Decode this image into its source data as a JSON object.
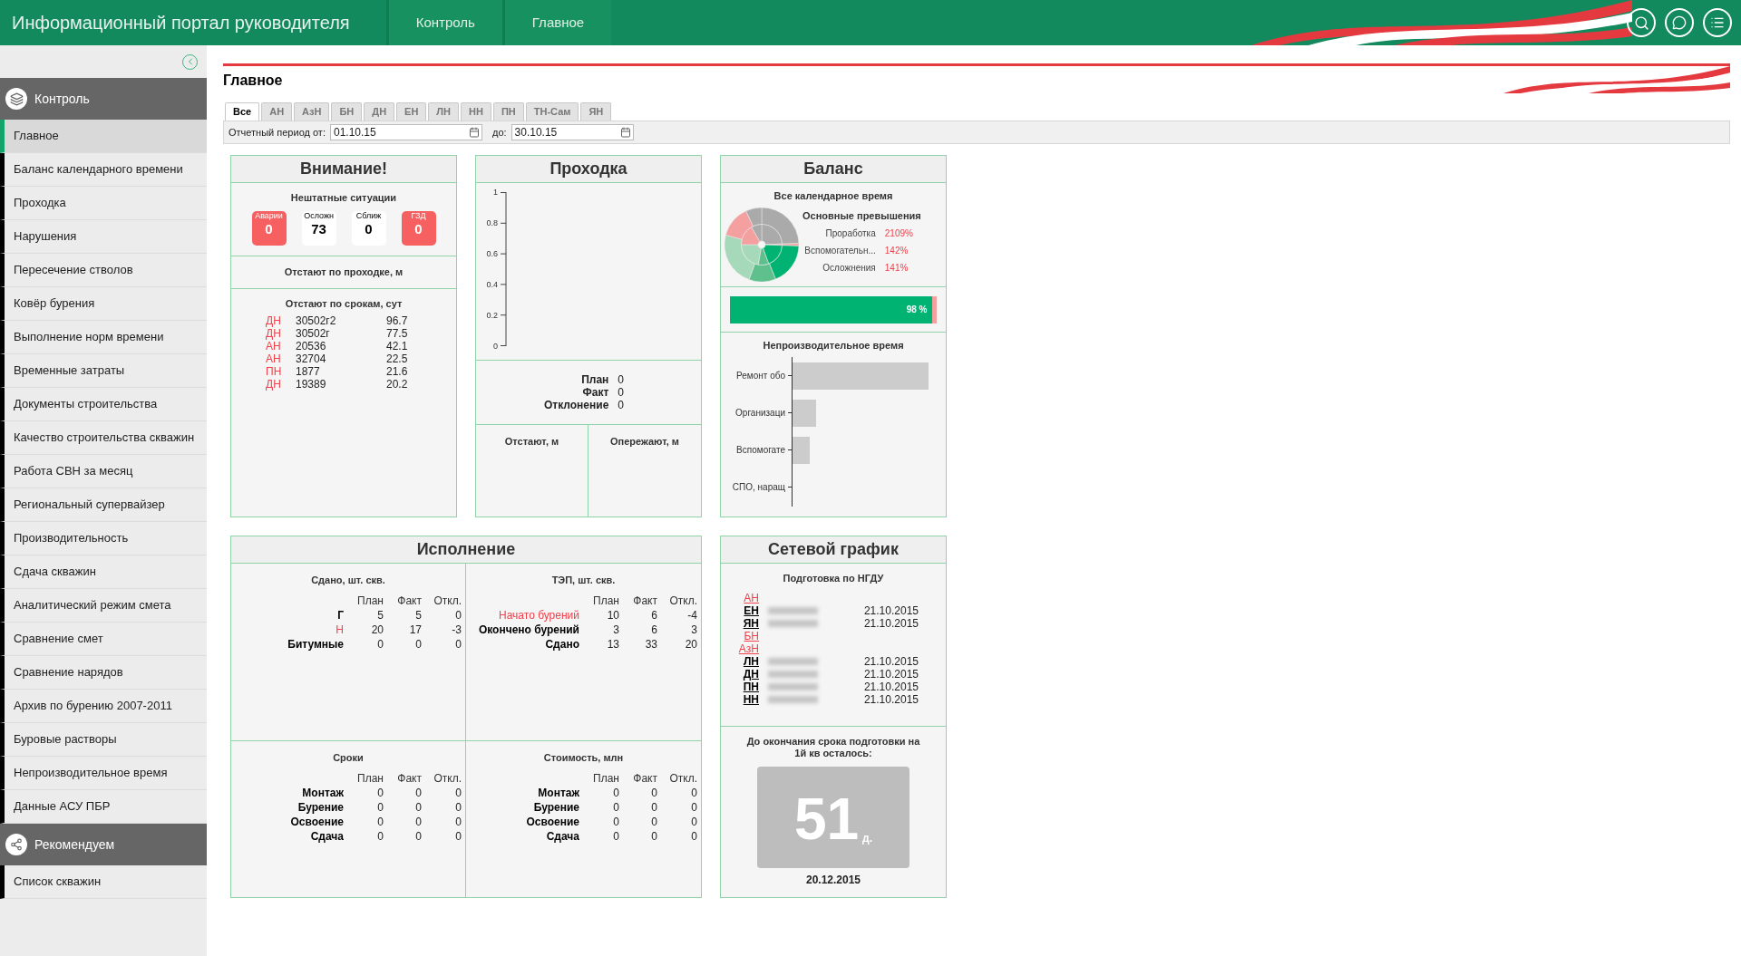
{
  "header": {
    "title": "Информационный портал руководителя",
    "breadcrumbs": [
      "Контроль",
      "Главное"
    ]
  },
  "sidebar": {
    "sections": [
      {
        "title": "Контроль",
        "items": [
          {
            "label": "Главное",
            "selected": true
          },
          {
            "label": "Баланс календарного времени",
            "selected": false
          },
          {
            "label": "Проходка",
            "selected": false
          },
          {
            "label": "Нарушения",
            "selected": false
          },
          {
            "label": "Пересечение стволов",
            "selected": false
          },
          {
            "label": "Ковёр бурения",
            "selected": false
          },
          {
            "label": "Выполнение норм времени",
            "selected": false
          },
          {
            "label": "Временные затраты",
            "selected": false
          },
          {
            "label": "Документы строительства",
            "selected": false
          },
          {
            "label": "Качество строительства скважин",
            "selected": false
          },
          {
            "label": "Работа СВН за месяц",
            "selected": false
          },
          {
            "label": "Региональный супервайзер",
            "selected": false
          },
          {
            "label": "Производительность",
            "selected": false
          },
          {
            "label": "Сдача скважин",
            "selected": false
          },
          {
            "label": "Аналитический режим смета",
            "selected": false
          },
          {
            "label": "Сравнение смет",
            "selected": false
          },
          {
            "label": "Сравнение нарядов",
            "selected": false
          },
          {
            "label": "Архив по бурению 2007-2011",
            "selected": false
          },
          {
            "label": "Буровые растворы",
            "selected": false
          },
          {
            "label": "Непроизводительное время",
            "selected": false
          },
          {
            "label": "Данные АСУ ПБР",
            "selected": false
          }
        ]
      },
      {
        "title": "Рекомендуем",
        "items": [
          {
            "label": "Список скважин",
            "selected": false
          }
        ]
      }
    ]
  },
  "page": {
    "title": "Главное"
  },
  "tabs": [
    {
      "label": "Все",
      "selected": true
    },
    {
      "label": "АН",
      "selected": false
    },
    {
      "label": "АзН",
      "selected": false
    },
    {
      "label": "БН",
      "selected": false
    },
    {
      "label": "ДН",
      "selected": false
    },
    {
      "label": "ЕН",
      "selected": false
    },
    {
      "label": "ЛН",
      "selected": false
    },
    {
      "label": "НН",
      "selected": false
    },
    {
      "label": "ПН",
      "selected": false
    },
    {
      "label": "ТН-Сам",
      "selected": false
    },
    {
      "label": "ЯН",
      "selected": false
    }
  ],
  "period": {
    "from_label": "Отчетный период от:",
    "from": "01.10.15",
    "to_label": "до:",
    "to": "30.10.15"
  },
  "attention": {
    "title": "Внимание!",
    "incidents_title": "Нештатные ситуации",
    "counters": [
      {
        "label": "Аварии",
        "value": "0",
        "alert": true
      },
      {
        "label": "Осложн",
        "value": "73",
        "alert": false
      },
      {
        "label": "Сближ",
        "value": "0",
        "alert": false
      },
      {
        "label": "ГЗД",
        "value": "0",
        "alert": true
      }
    ],
    "drilling_lag_title": "Отстают по проходке, м",
    "deadline_title": "Отстают по срокам, сут",
    "deadline_rows": [
      {
        "unit": "ДН",
        "well": "30502г2",
        "days": "96.7"
      },
      {
        "unit": "ДН",
        "well": "30502г",
        "days": "77.5"
      },
      {
        "unit": "АН",
        "well": "20536",
        "days": "42.1"
      },
      {
        "unit": "АН",
        "well": "32704",
        "days": "22.5"
      },
      {
        "unit": "ПН",
        "well": "1877",
        "days": "21.6"
      },
      {
        "unit": "ДН",
        "well": "19389",
        "days": "20.2"
      }
    ]
  },
  "drilling": {
    "title": "Проходка",
    "axis_labels": [
      "1",
      "0.8",
      "0.6",
      "0.4",
      "0.2",
      "0"
    ],
    "stats": [
      {
        "label": "План",
        "value": "0"
      },
      {
        "label": "Факт",
        "value": "0"
      },
      {
        "label": "Отклонение",
        "value": "0"
      }
    ],
    "behind_title": "Отстают, м",
    "ahead_title": "Опережают, м"
  },
  "balance": {
    "title": "Баланс",
    "calendar_title": "Все календарное время",
    "excess_title": "Основные превышения",
    "excesses": [
      {
        "label": "Проработка",
        "value": "2109%"
      },
      {
        "label": "Вспомогательн...",
        "value": "142%"
      },
      {
        "label": "Осложнения",
        "value": "141%"
      }
    ],
    "progress": {
      "level": 0.98,
      "reading": "98 %"
    },
    "unproductive_title": "Непроизводительное время",
    "unproductive_categories": [
      "Ремонт обо",
      "Организаци",
      "Вспомогате",
      "СПО, наращ"
    ]
  },
  "execution": {
    "title": "Исполнение",
    "tables": [
      {
        "title": "Сдано, шт. скв.",
        "columns": [
          "План",
          "Факт",
          "Откл."
        ],
        "rows": [
          {
            "label": "Г",
            "alert": false,
            "cells": [
              "5",
              "5",
              "0"
            ]
          },
          {
            "label": "Н",
            "alert": true,
            "cells": [
              "20",
              "17",
              "-3"
            ]
          },
          {
            "label": "Битумные",
            "alert": false,
            "cells": [
              "0",
              "0",
              "0"
            ]
          }
        ]
      },
      {
        "title": "ТЭП, шт. скв.",
        "columns": [
          "План",
          "Факт",
          "Откл."
        ],
        "rows": [
          {
            "label": "Начато бурений",
            "alert": true,
            "cells": [
              "10",
              "6",
              "-4"
            ]
          },
          {
            "label": "Окончено бурений",
            "alert": false,
            "cells": [
              "3",
              "6",
              "3"
            ]
          },
          {
            "label": "Сдано",
            "alert": false,
            "cells": [
              "13",
              "33",
              "20"
            ]
          }
        ]
      },
      {
        "title": "Сроки",
        "columns": [
          "План",
          "Факт",
          "Откл."
        ],
        "rows": [
          {
            "label": "Монтаж",
            "alert": false,
            "cells": [
              "0",
              "0",
              "0"
            ]
          },
          {
            "label": "Бурение",
            "alert": false,
            "cells": [
              "0",
              "0",
              "0"
            ]
          },
          {
            "label": "Освоение",
            "alert": false,
            "cells": [
              "0",
              "0",
              "0"
            ]
          },
          {
            "label": "Сдача",
            "alert": false,
            "cells": [
              "0",
              "0",
              "0"
            ]
          }
        ]
      },
      {
        "title": "Стоимость, млн",
        "columns": [
          "План",
          "Факт",
          "Откл."
        ],
        "rows": [
          {
            "label": "Монтаж",
            "alert": false,
            "cells": [
              "0",
              "0",
              "0"
            ]
          },
          {
            "label": "Бурение",
            "alert": false,
            "cells": [
              "0",
              "0",
              "0"
            ]
          },
          {
            "label": "Освоение",
            "alert": false,
            "cells": [
              "0",
              "0",
              "0"
            ]
          },
          {
            "label": "Сдача",
            "alert": false,
            "cells": [
              "0",
              "0",
              "0"
            ]
          }
        ]
      }
    ]
  },
  "network": {
    "title": "Сетевой график",
    "subtitle": "Подготовка по НГДУ",
    "rows": [
      {
        "unit": "АН",
        "overdue": true,
        "redacted": false
      },
      {
        "unit": "ЕН",
        "overdue": false,
        "redacted": true,
        "date": "21.10.2015"
      },
      {
        "unit": "ЯН",
        "overdue": false,
        "redacted": true,
        "date": "21.10.2015"
      },
      {
        "unit": "БН",
        "overdue": true,
        "redacted": false
      },
      {
        "unit": "АзН",
        "overdue": true,
        "redacted": false
      },
      {
        "unit": "ЛН",
        "overdue": false,
        "redacted": true,
        "date": "21.10.2015"
      },
      {
        "unit": "ДН",
        "overdue": false,
        "redacted": true,
        "date": "21.10.2015"
      },
      {
        "unit": "ПН",
        "overdue": false,
        "redacted": true,
        "date": "21.10.2015"
      },
      {
        "unit": "НН",
        "overdue": false,
        "redacted": true,
        "date": "21.10.2015"
      }
    ],
    "countdown_title": "До окончания срока подготовки на 1й кв осталось:",
    "days": "51",
    "days_unit": "д.",
    "deadline": "20.12.2015"
  }
}
